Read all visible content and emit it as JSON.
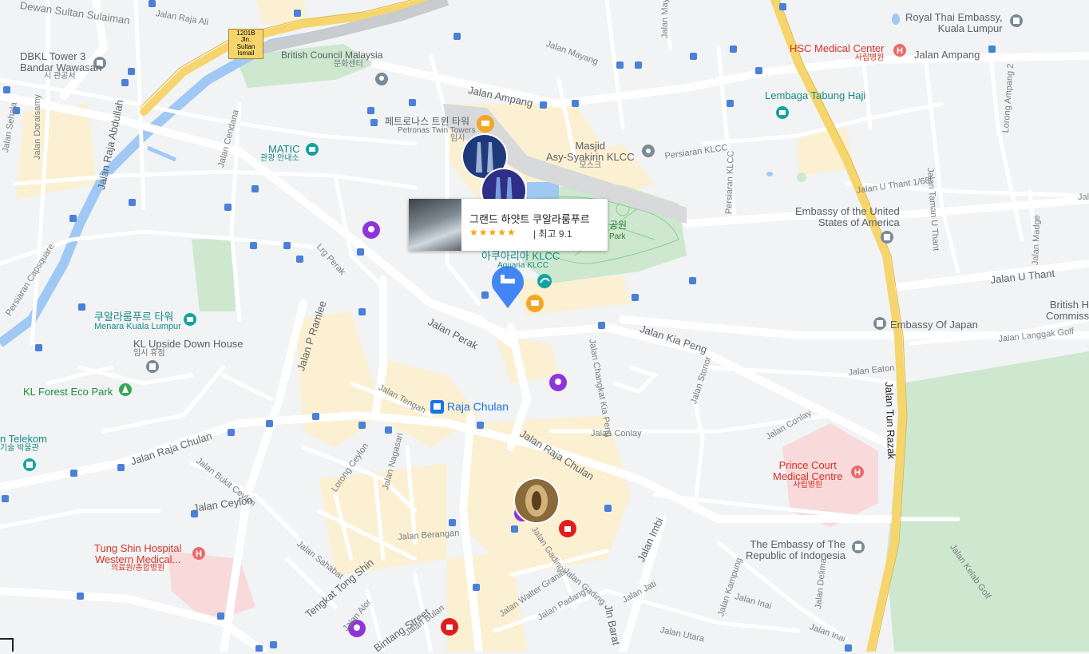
{
  "hotel_card": {
    "name": "그랜드 하얏트 쿠알라룸푸르",
    "stars": "★★★★★",
    "score": "| 최고 9.1"
  },
  "pois": {
    "british_council": "British Council Malaysia",
    "british_council_sub": "문화센터",
    "petronas": "페트로나스 트윈 타워",
    "petronas_en": "Petronas Twin Towers",
    "petronas_sub": "임시",
    "matic": "MATIC",
    "matic_sub": "관광 안내소",
    "dbkl": "DBKL Tower 3",
    "dbkl2": "Bandar Wawasan",
    "dbkl_sub": "시 관공서",
    "masjid": "Masjid",
    "masjid2": "Asy-Syakirin KLCC",
    "masjid_sub": "모스크",
    "royal_thai": "Royal Thai Embassy,",
    "royal_thai2": "Kuala Lumpur",
    "hsc": "HSC Medical Center",
    "hsc_sub": "사립병원",
    "tabung": "Lembaga Tabung Haji",
    "us_embassy": "Embassy of the United",
    "us_embassy2": "States of America",
    "aquaria": "아쿠아리아 KLCC",
    "aquaria_en": "Aquaria KLCC",
    "park": "공원",
    "park_en": "Park",
    "kl_tower": "쿠알라룸푸르 타워",
    "kl_tower_en": "Menara Kuala Lumpur",
    "upside": "KL Upside Down House",
    "upside_sub": "임시 휴점",
    "eco_park": "KL Forest Eco Park",
    "raja_chulan": "Raja Chulan",
    "telekom": "n Telekom",
    "telekom_sub": "기술 박물관",
    "japan": "Embassy Of Japan",
    "british_high": "British H",
    "british_high2": "Commissione",
    "prince_court": "Prince Court",
    "prince_court2": "Medical Centre",
    "prince_court_sub": "사립병원",
    "indonesia": "The Embassy of The",
    "indonesia2": "Republic of Indonesia",
    "tung_shin": "Tung Shin Hospital",
    "tung_shin2": "Western Medical...",
    "tung_shin_sub": "의료원/종합병원"
  },
  "roads": {
    "sultan_sulaiman": "Dewan Sultan Sulaiman",
    "raja_ali": "Jalan Raja Ali",
    "sultan_ismail": "1201B Jln. Sultan Ismail",
    "mayang": "Jalan Mayang",
    "ampang_w": "Jalan Ampang",
    "ampang_e": "Jalan Ampang",
    "maya": "Jalan Maya",
    "sehala": "Jalan Sehala",
    "doraisamy": "Jalan Doraisamy",
    "raja_abdullah": "Jalan Raja Abdullah",
    "cendana": "Jalan Cendana",
    "persiaran_klcc": "Persiaran KLCC",
    "persiaran_klcc_v": "Persiaran KLCC",
    "u_thant_1": "Jalan U Thant 1/68f",
    "taman_u_thant": "Jalan Taman U Thant",
    "madge": "Jalan Madge",
    "u_thant": "Jalan U Thant",
    "lorong_ampang": "Lorong Ampang 2",
    "capsquare": "Persiaran Capsquare",
    "lrg_perak": "Lrg Perak",
    "p_ramlee": "Jalan P Ramlee",
    "perak": "Jalan Perak",
    "kia_peng": "Jalan Kia Peng",
    "changkat_kia_peng": "Jalan Changkat Kia Peng",
    "stonor": "Jalan Stonor",
    "langgak_golf": "Jalan Langgak Golf",
    "eaton": "Jalan Eaton",
    "tun_razak": "Jalan Tun Razak",
    "tengah": "Jalan Tengah",
    "conlay": "Jalan Conlay",
    "conlay2": "Jalan Conlay",
    "raja_chulan_w": "Jalan Raja Chulan",
    "raja_chulan_e": "Jalan Raja Chulan",
    "bukit_ceylon": "Jalan Bukit Ceylon",
    "lorong_ceylon": "Lorong Ceylon",
    "nagasari": "Jalan Nagasari",
    "ceylon": "Jalan Ceylon",
    "berangan": "Jalan Berangan",
    "sahabat": "Jalan Sahabat",
    "tengkat_tong_shin": "Tengkat Tong Shin",
    "alor": "Jalan Alor",
    "bintang": "Bintang Street",
    "bulan": "Jalan Bulan",
    "gading": "Jalan Gading",
    "gading2": "Jalan Gading",
    "walter_granier": "Jalan Walter Granier",
    "padang": "Jalan Padang",
    "imbi": "Jalan Imbi",
    "jati": "Jalan Jati",
    "barat": "Jln Barat",
    "kampung": "Jalan Kampung",
    "inai": "Jalan Inai",
    "inai2": "Jalan Inai",
    "delima": "Jalan Delima",
    "utara": "Jalan Utara",
    "kelab_golf": "Jalan Kelab Golf",
    "pe": "Jalan Pe"
  },
  "colors": {
    "water": "#9fc8f5",
    "park": "#c8e6c9",
    "highway": "#f9d871",
    "commercial": "#fcf1d6",
    "hospital": "#f7dede",
    "transit": "#1a73e8",
    "hotel_pin": "#4285f4"
  }
}
